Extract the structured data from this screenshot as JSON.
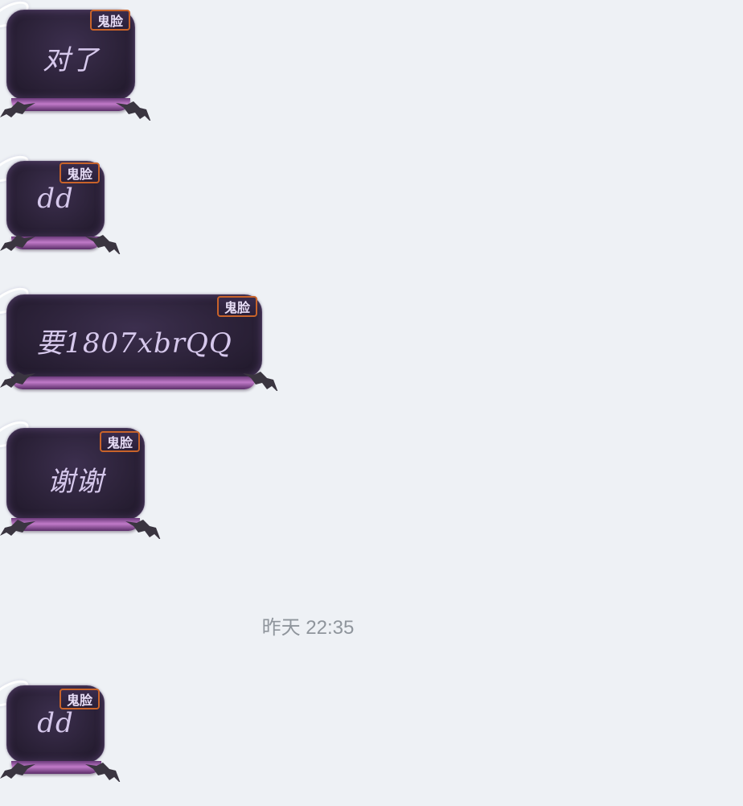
{
  "messages": [
    {
      "text": "对了",
      "tag": "鬼脸"
    },
    {
      "text": "dd",
      "tag": "鬼脸"
    },
    {
      "text": "要1807xbrQQ",
      "tag": "鬼脸"
    },
    {
      "text": "谢谢",
      "tag": "鬼脸"
    },
    {
      "text": "dd",
      "tag": "鬼脸"
    }
  ],
  "timestamp": "昨天 22:35",
  "colors": {
    "background": "#eef1f5",
    "bubble": "#2c2239",
    "bubble_text": "#d6c8ec",
    "tag_border": "#c8632a",
    "timestamp": "#8f959c"
  }
}
